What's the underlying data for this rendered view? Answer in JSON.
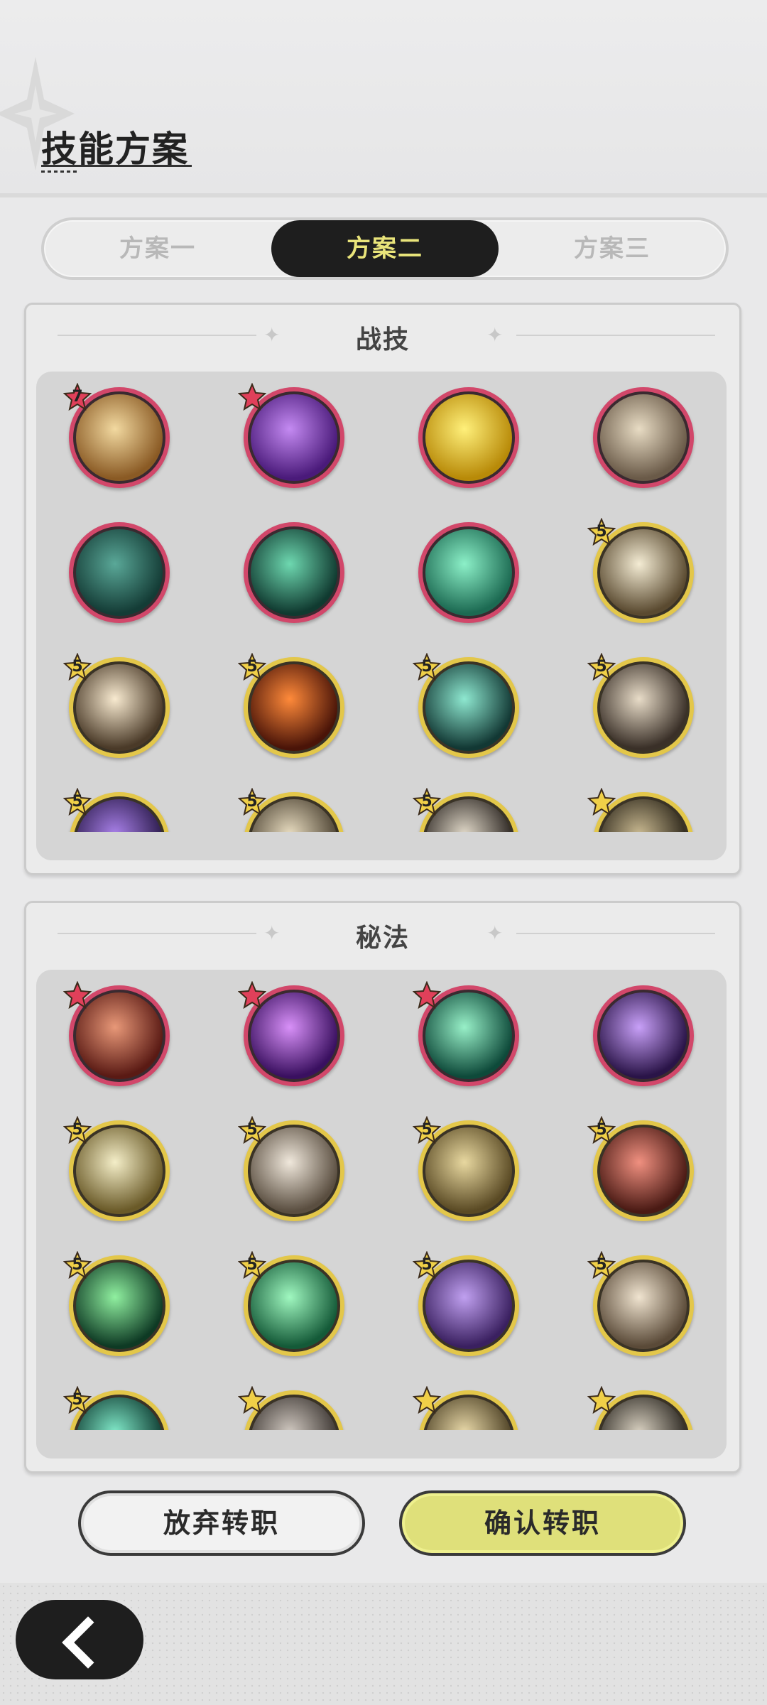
{
  "header": {
    "title": "技能方案"
  },
  "tabs": [
    {
      "label": "方案一",
      "selected": false
    },
    {
      "label": "方案二",
      "selected": true
    },
    {
      "label": "方案三",
      "selected": false
    }
  ],
  "sections": [
    {
      "title": "战技",
      "icons": [
        {
          "name": "golden-slash-icon",
          "ring": "red",
          "badge": "7",
          "colors": [
            "#f2d9a0",
            "#8a5a24"
          ]
        },
        {
          "name": "purple-roses-icon",
          "ring": "red",
          "badge": "",
          "colors": [
            "#c48af2",
            "#4a1a7a"
          ]
        },
        {
          "name": "golden-shield-up-icon",
          "ring": "red",
          "badge": "",
          "colors": [
            "#fff07a",
            "#b88a08"
          ]
        },
        {
          "name": "grasping-hand-icon",
          "ring": "red",
          "badge": "",
          "colors": [
            "#e8dcc4",
            "#6a5a48"
          ]
        },
        {
          "name": "spider-web-icon",
          "ring": "red",
          "badge": "",
          "colors": [
            "#5aa898",
            "#143c36"
          ]
        },
        {
          "name": "sword-burst-icon",
          "ring": "red",
          "badge": "",
          "colors": [
            "#6ed8b0",
            "#103a30"
          ]
        },
        {
          "name": "green-whirl-up-icon",
          "ring": "red",
          "badge": "",
          "colors": [
            "#8cf0c8",
            "#1c6a52"
          ]
        },
        {
          "name": "light-spear-icon",
          "ring": "gold",
          "badge": "5",
          "colors": [
            "#f4ecd4",
            "#5a4a30"
          ]
        },
        {
          "name": "earth-explosion-icon",
          "ring": "gold",
          "badge": "5",
          "colors": [
            "#f8ead0",
            "#4a3a28"
          ]
        },
        {
          "name": "fire-swirl-icon",
          "ring": "gold",
          "badge": "5",
          "colors": [
            "#ff8a3a",
            "#4a1408"
          ]
        },
        {
          "name": "wind-crescent-icon",
          "ring": "gold",
          "badge": "5",
          "colors": [
            "#8ee8d0",
            "#123834"
          ]
        },
        {
          "name": "roaring-face-icon",
          "ring": "gold",
          "badge": "5",
          "colors": [
            "#e8dcc8",
            "#3a3028"
          ]
        },
        {
          "name": "purple-wave-icon",
          "ring": "gold",
          "badge": "5",
          "colors": [
            "#a880e8",
            "#2a1a4a"
          ]
        },
        {
          "name": "beige-swirl-icon",
          "ring": "gold",
          "badge": "5",
          "colors": [
            "#e8dcc0",
            "#4a4030"
          ]
        },
        {
          "name": "dark-claw-icon",
          "ring": "gold",
          "badge": "5",
          "colors": [
            "#e0d8c8",
            "#2a2420"
          ]
        },
        {
          "name": "dark-arc-icon",
          "ring": "gold",
          "badge": "",
          "colors": [
            "#c8b890",
            "#2a2418"
          ]
        }
      ]
    },
    {
      "title": "秘法",
      "icons": [
        {
          "name": "red-fist-icon",
          "ring": "red",
          "badge": "",
          "colors": [
            "#e89878",
            "#5a1a14"
          ]
        },
        {
          "name": "purple-flame-icon",
          "ring": "red",
          "badge": "",
          "colors": [
            "#d890f8",
            "#3a1060"
          ]
        },
        {
          "name": "green-heal-circle-icon",
          "ring": "red",
          "badge": "",
          "colors": [
            "#98f0c8",
            "#0e4a3a"
          ]
        },
        {
          "name": "purple-figure-icon",
          "ring": "red",
          "badge": "",
          "colors": [
            "#c8a0f8",
            "#2a1448"
          ]
        },
        {
          "name": "all-seeing-eye-icon",
          "ring": "gold",
          "badge": "5",
          "colors": [
            "#f4eec8",
            "#6a5a28"
          ]
        },
        {
          "name": "crystal-blade-icon",
          "ring": "gold",
          "badge": "5",
          "colors": [
            "#f0e8dc",
            "#5a4e40"
          ]
        },
        {
          "name": "golden-guardian-icon",
          "ring": "gold",
          "badge": "5",
          "colors": [
            "#e8d8a0",
            "#5a4a24"
          ]
        },
        {
          "name": "crimson-armor-icon",
          "ring": "gold",
          "badge": "5",
          "colors": [
            "#f09080",
            "#4a1a14"
          ]
        },
        {
          "name": "green-leaf-slash-icon",
          "ring": "gold",
          "badge": "5",
          "colors": [
            "#90f0a0",
            "#0e3a24"
          ]
        },
        {
          "name": "green-heart-icon",
          "ring": "gold",
          "badge": "5",
          "colors": [
            "#a0f8c0",
            "#145a38"
          ]
        },
        {
          "name": "purple-beast-icon",
          "ring": "gold",
          "badge": "5",
          "colors": [
            "#c0a0f0",
            "#3a2060"
          ]
        },
        {
          "name": "sword-upgrade-icon",
          "ring": "gold",
          "badge": "5",
          "colors": [
            "#f0e4d0",
            "#5a4a38"
          ]
        },
        {
          "name": "teal-orb-icon",
          "ring": "gold",
          "badge": "5",
          "colors": [
            "#80e8c8",
            "#0e3a30"
          ]
        },
        {
          "name": "grey-rune-icon",
          "ring": "gold",
          "badge": "",
          "colors": [
            "#d0c8c0",
            "#3a3430"
          ]
        },
        {
          "name": "golden-crest-icon",
          "ring": "gold",
          "badge": "",
          "colors": [
            "#e8d8a8",
            "#4a3e22"
          ]
        },
        {
          "name": "shadow-spike-icon",
          "ring": "gold",
          "badge": "",
          "colors": [
            "#d8d0c0",
            "#2a2620"
          ]
        }
      ]
    }
  ],
  "buttons": {
    "cancel": "放弃转职",
    "confirm": "确认转职"
  },
  "colors": {
    "accent_yellow": "#dfe07a",
    "selected_tab_bg": "#1e1e1e",
    "selected_tab_text": "#e9e47a",
    "red_ring": "#d2476a",
    "gold_ring": "#e3c74a"
  }
}
